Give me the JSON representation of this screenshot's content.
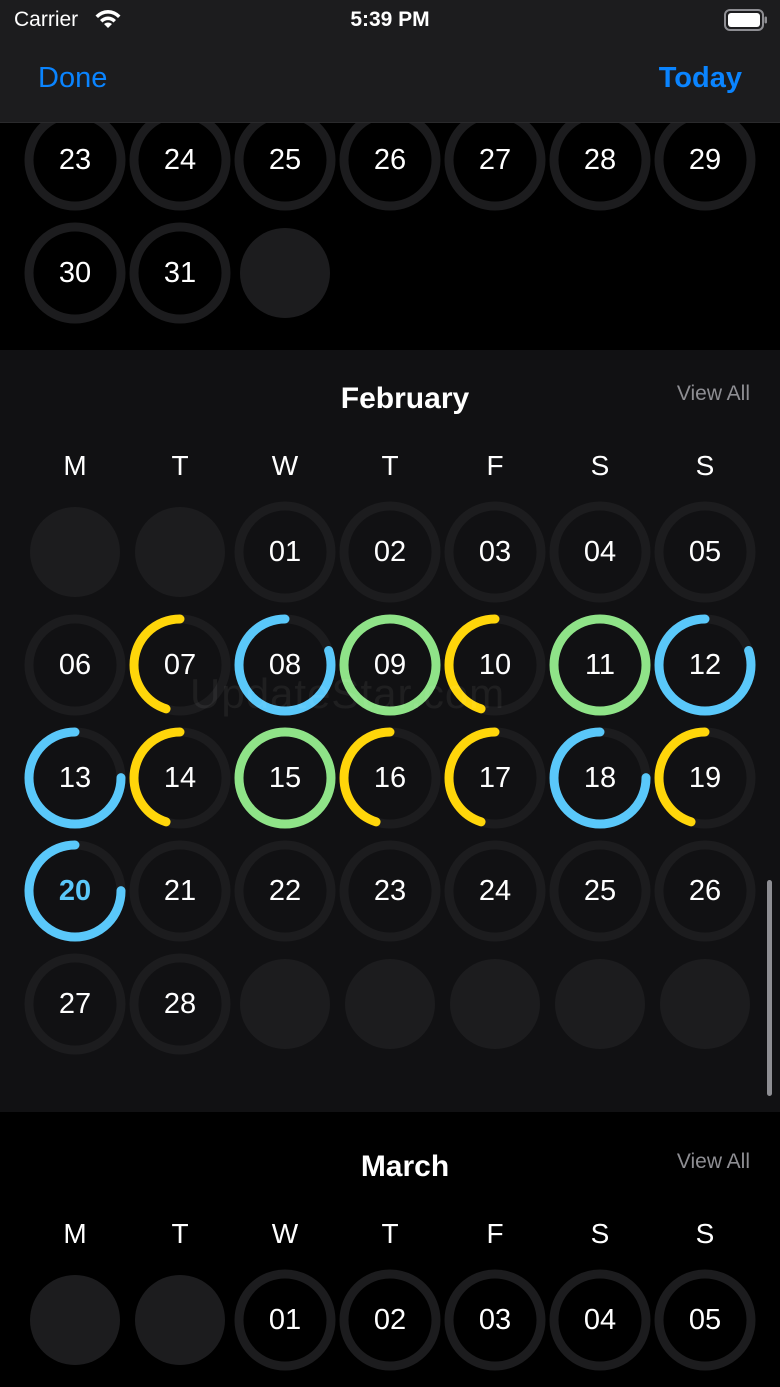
{
  "status_bar": {
    "carrier": "Carrier",
    "time": "5:39 PM"
  },
  "nav": {
    "done_label": "Done",
    "today_label": "Today"
  },
  "colors": {
    "accent": "#0a84ff",
    "ring_blue": "#5ac8fa",
    "ring_yellow": "#ffd60a",
    "ring_green": "#8fe388",
    "ring_track": "#1c1c1e",
    "empty_cell": "#1c1c1e"
  },
  "weekdays": [
    "M",
    "T",
    "W",
    "T",
    "F",
    "S",
    "S"
  ],
  "watermark": "UpdateStar.com",
  "months": [
    {
      "name": "",
      "view_all": "",
      "background": "#000000",
      "show_weekdays": false,
      "weeks": [
        [
          {
            "day": "23"
          },
          {
            "day": "24"
          },
          {
            "day": "25"
          },
          {
            "day": "26"
          },
          {
            "day": "27"
          },
          {
            "day": "28"
          },
          {
            "day": "29"
          }
        ],
        [
          {
            "day": "30"
          },
          {
            "day": "31"
          },
          {
            "day": "",
            "empty": true
          }
        ]
      ]
    },
    {
      "name": "February",
      "view_all": "View All",
      "background": "#111113",
      "show_weekdays": true,
      "weeks": [
        [
          {
            "day": "",
            "empty": true
          },
          {
            "day": "",
            "empty": true
          },
          {
            "day": "01"
          },
          {
            "day": "02"
          },
          {
            "day": "03"
          },
          {
            "day": "04"
          },
          {
            "day": "05"
          }
        ],
        [
          {
            "day": "06"
          },
          {
            "day": "07",
            "ring": "yellow",
            "progress": 0.45
          },
          {
            "day": "08",
            "ring": "blue",
            "progress": 0.8
          },
          {
            "day": "09",
            "ring": "green",
            "progress": 1
          },
          {
            "day": "10",
            "ring": "yellow",
            "progress": 0.45
          },
          {
            "day": "11",
            "ring": "green",
            "progress": 1
          },
          {
            "day": "12",
            "ring": "blue",
            "progress": 0.8
          }
        ],
        [
          {
            "day": "13",
            "ring": "blue",
            "progress": 0.75
          },
          {
            "day": "14",
            "ring": "yellow",
            "progress": 0.45
          },
          {
            "day": "15",
            "ring": "green",
            "progress": 1
          },
          {
            "day": "16",
            "ring": "yellow",
            "progress": 0.45
          },
          {
            "day": "17",
            "ring": "yellow",
            "progress": 0.45
          },
          {
            "day": "18",
            "ring": "blue",
            "progress": 0.75
          },
          {
            "day": "19",
            "ring": "yellow",
            "progress": 0.45
          }
        ],
        [
          {
            "day": "20",
            "ring": "blue",
            "progress": 0.75,
            "today": true
          },
          {
            "day": "21"
          },
          {
            "day": "22"
          },
          {
            "day": "23"
          },
          {
            "day": "24"
          },
          {
            "day": "25"
          },
          {
            "day": "26"
          }
        ],
        [
          {
            "day": "27"
          },
          {
            "day": "28"
          },
          {
            "day": "",
            "empty": true
          },
          {
            "day": "",
            "empty": true
          },
          {
            "day": "",
            "empty": true
          },
          {
            "day": "",
            "empty": true
          },
          {
            "day": "",
            "empty": true
          }
        ]
      ]
    },
    {
      "name": "March",
      "view_all": "View All",
      "background": "#000000",
      "show_weekdays": true,
      "weeks": [
        [
          {
            "day": "",
            "empty": true
          },
          {
            "day": "",
            "empty": true
          },
          {
            "day": "01"
          },
          {
            "day": "02"
          },
          {
            "day": "03"
          },
          {
            "day": "04"
          },
          {
            "day": "05"
          }
        ]
      ]
    }
  ]
}
